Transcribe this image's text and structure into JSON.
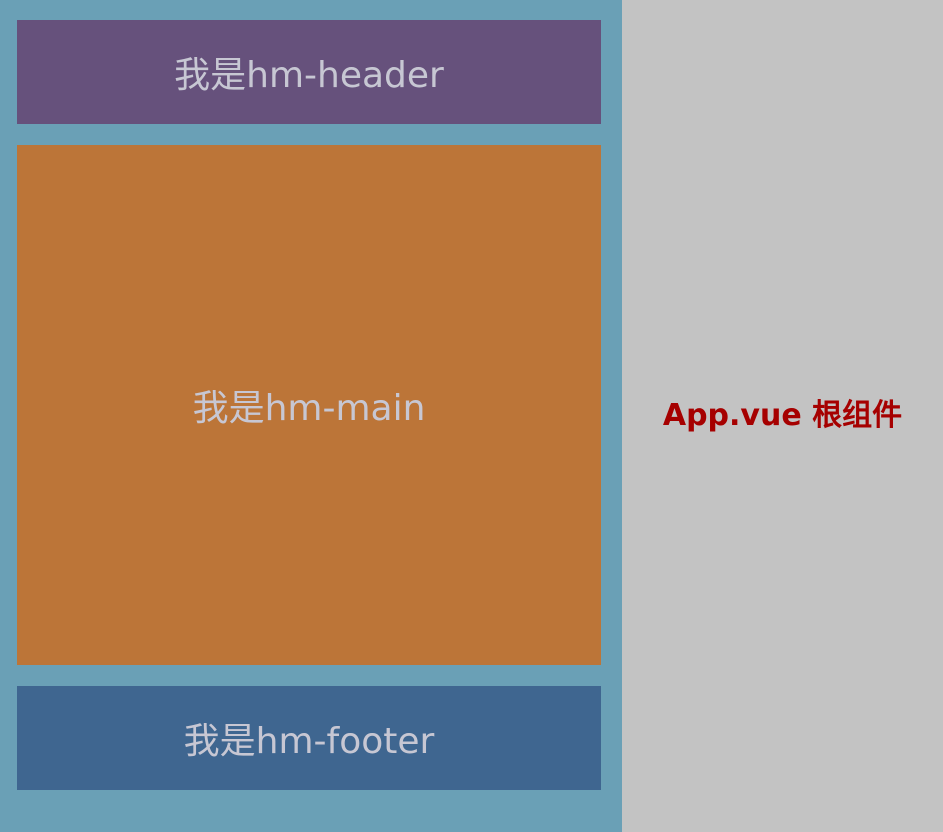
{
  "app": {
    "header_text": "我是hm-header",
    "main_text": "我是hm-main",
    "footer_text": "我是hm-footer",
    "root_label": "App.vue 根组件"
  },
  "colors": {
    "page_background": "#c3c3c3",
    "column_background": "#6aa0b6",
    "header": "#66517c",
    "main": "#bc7538",
    "footer": "#3f6690",
    "label_text": "#a60000"
  }
}
